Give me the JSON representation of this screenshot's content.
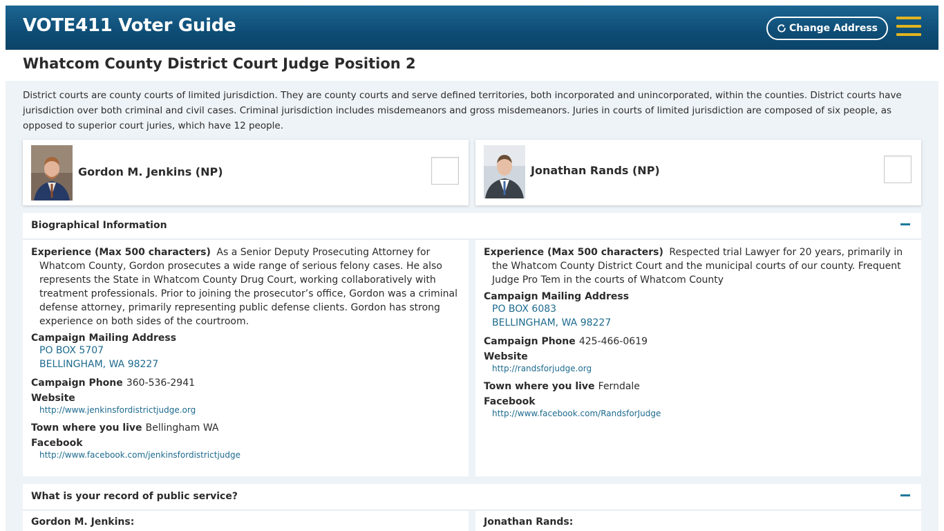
{
  "header": {
    "title": "VOTE411 Voter Guide",
    "change_address": "Change Address"
  },
  "race": {
    "title": "Whatcom County District Court Judge Position 2",
    "description": "District courts are county courts of limited jurisdiction. They are county courts and serve defined territories, both incorporated and unincorporated, within the counties. District courts have jurisdiction over both criminal and civil cases. Criminal jurisdiction includes misdemeanors and gross misdemeanors. Juries in courts of limited jurisdiction are composed of six people, as opposed to superior court juries, which have 12 people."
  },
  "candidates": [
    {
      "name": "Gordon M. Jenkins (NP)",
      "experience_label": "Experience (Max 500 characters)",
      "experience": "As a Senior Deputy Prosecuting Attorney for Whatcom County, Gordon prosecutes a wide range of serious felony cases. He also represents the State in Whatcom County Drug Court, working collaboratively with treatment professionals. Prior to joining the prosecutor’s office, Gordon was a criminal defense attorney, primarily representing public defense clients. Gordon has strong experience on both sides of the courtroom.",
      "address_label": "Campaign Mailing Address",
      "address_line1": "PO BOX 5707",
      "address_line2": "BELLINGHAM, WA 98227",
      "phone_label": "Campaign Phone",
      "phone": "360-536-2941",
      "website_label": "Website",
      "website": "http://www.jenkinsfordistrictjudge.org",
      "town_label": "Town where you live",
      "town": "Bellingham WA",
      "facebook_label": "Facebook",
      "facebook": "http://www.facebook.com/jenkinsfordistrictjudge",
      "short_name": "Gordon M. Jenkins:"
    },
    {
      "name": "Jonathan Rands (NP)",
      "experience_label": "Experience (Max 500 characters)",
      "experience": "Respected trial Lawyer for 20 years, primarily in the Whatcom County District Court and the municipal courts of our county. Frequent Judge Pro Tem in the courts of Whatcom County",
      "address_label": "Campaign Mailing Address",
      "address_line1": "PO BOX 6083",
      "address_line2": "BELLINGHAM, WA 98227",
      "phone_label": "Campaign Phone",
      "phone": "425-466-0619",
      "website_label": "Website",
      "website": "http://randsforjudge.org",
      "town_label": "Town where you live",
      "town": "Ferndale",
      "facebook_label": "Facebook",
      "facebook": "http://www.facebook.com/RandsforJudge",
      "short_name": "Jonathan Rands:"
    }
  ],
  "sections": {
    "bio": "Biographical Information",
    "public_service": "What is your record of public service?"
  },
  "icons": {
    "refresh": "refresh-icon",
    "menu": "hamburger-menu-icon",
    "collapse": "minus-icon"
  },
  "colors": {
    "header_bg": "#0e4d75",
    "menu_accent": "#e2b41f",
    "link": "#1d6a8e",
    "content_bg": "#eef3f7"
  }
}
